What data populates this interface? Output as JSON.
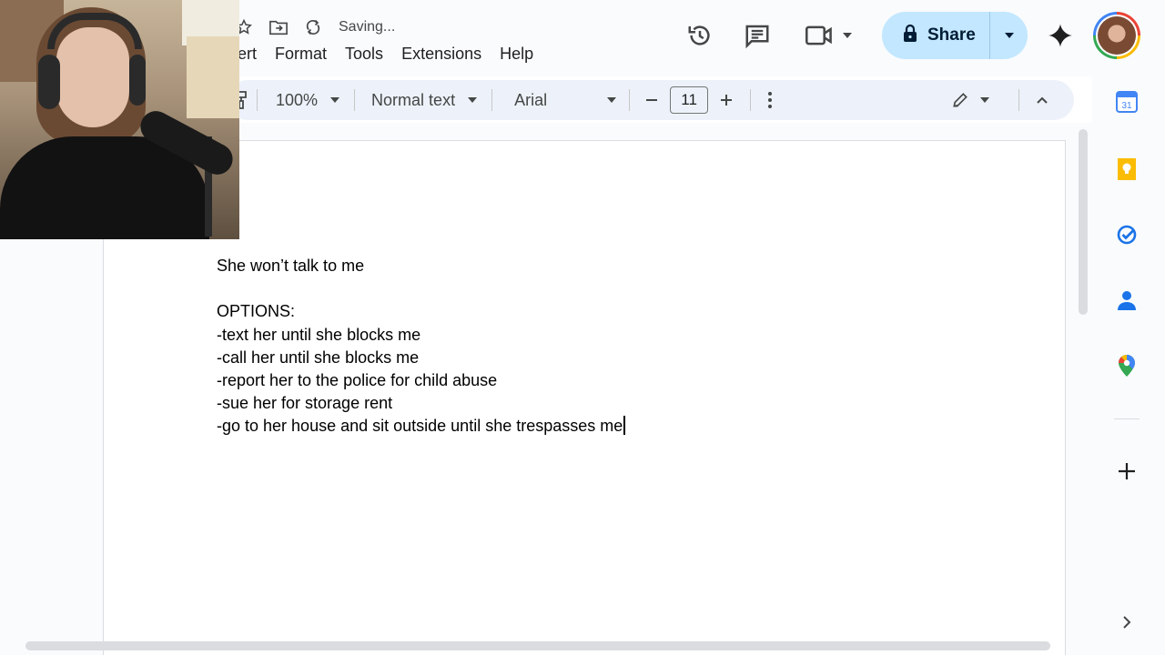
{
  "header": {
    "saving_status": "Saving...",
    "menu": [
      "sert",
      "Format",
      "Tools",
      "Extensions",
      "Help"
    ],
    "share_label": "Share"
  },
  "toolbar": {
    "zoom": "100%",
    "style": "Normal text",
    "font": "Arial",
    "font_size": "11"
  },
  "document": {
    "lines": [
      "She won’t talk to me",
      "",
      "OPTIONS:",
      "-text her until she blocks me",
      "-call her until she blocks me",
      "-report her to the police for child abuse",
      "-sue her for storage rent",
      "-go to her house and sit outside until she trespasses me"
    ]
  },
  "sidepanel": {
    "calendar_day": "31"
  },
  "colors": {
    "share_bg": "#c2e7ff",
    "toolbar_bg": "#edf2fa",
    "header_bg": "#f9fbfd",
    "keep_yellow": "#fbbc04",
    "tasks_blue": "#1a73e8"
  },
  "icons": [
    "star-icon",
    "move-to-folder-icon",
    "sync-icon",
    "history-icon",
    "comments-icon",
    "video-call-icon",
    "lock-icon",
    "gemini-icon",
    "paint-format-icon",
    "more-vert-icon",
    "edit-pencil-icon",
    "chevron-up-icon",
    "calendar-icon",
    "keep-icon",
    "tasks-icon",
    "contacts-icon",
    "maps-icon",
    "add-icon",
    "chevron-right-icon"
  ]
}
